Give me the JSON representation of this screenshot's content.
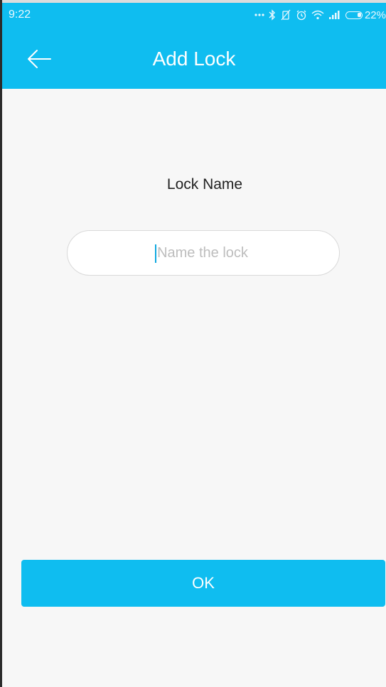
{
  "status_bar": {
    "time": "9:22",
    "battery_text": "22%",
    "icons": [
      "more-dots-icon",
      "bluetooth-icon",
      "vibrate-off-icon",
      "alarm-icon",
      "wifi-icon",
      "signal-icon",
      "battery-icon"
    ]
  },
  "app_bar": {
    "title": "Add Lock",
    "back_icon": "back-arrow-icon"
  },
  "form": {
    "label": "Lock Name",
    "name_input": {
      "value": "",
      "placeholder": "Name the lock"
    }
  },
  "actions": {
    "ok_label": "OK"
  },
  "colors": {
    "accent": "#0fbdf0",
    "background": "#f7f7f7",
    "input_border": "#d9d9d9",
    "placeholder": "#bdbdbd"
  }
}
